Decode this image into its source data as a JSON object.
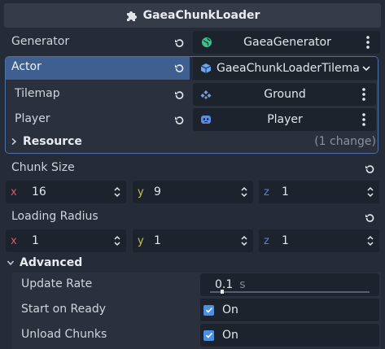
{
  "header": {
    "title": "GaeaChunkLoader",
    "icon": "puzzle-icon"
  },
  "generator": {
    "label": "Generator",
    "value": "GaeaGenerator",
    "icon": "globe-icon"
  },
  "actor": {
    "label": "Actor",
    "value": "GaeaChunkLoaderTilema",
    "icon": "cube-icon",
    "rows": [
      {
        "label": "Tilemap",
        "value": "Ground",
        "icon": "tilemap-icon"
      },
      {
        "label": "Player",
        "value": "Player",
        "icon": "robot-icon"
      }
    ],
    "resource": {
      "label": "Resource",
      "changes": "(1 change)"
    }
  },
  "chunk_size": {
    "label": "Chunk Size",
    "x": "16",
    "y": "9",
    "z": "1"
  },
  "loading_radius": {
    "label": "Loading Radius",
    "x": "1",
    "y": "1",
    "z": "1"
  },
  "axis_labels": {
    "x": "x",
    "y": "y",
    "z": "z"
  },
  "advanced": {
    "label": "Advanced",
    "update_rate": {
      "label": "Update Rate",
      "value": "0.1",
      "unit": "s"
    },
    "start_on_ready": {
      "label": "Start on Ready",
      "value": "On",
      "checked": true
    },
    "unload_chunks": {
      "label": "Unload Chunks",
      "value": "On",
      "checked": true
    }
  },
  "colors": {
    "accent": "#4d90e0",
    "actor_highlight": "#3e5f8f",
    "axis_x": "#e0566b",
    "axis_y": "#c2c95a",
    "axis_z": "#5c7fe0"
  }
}
